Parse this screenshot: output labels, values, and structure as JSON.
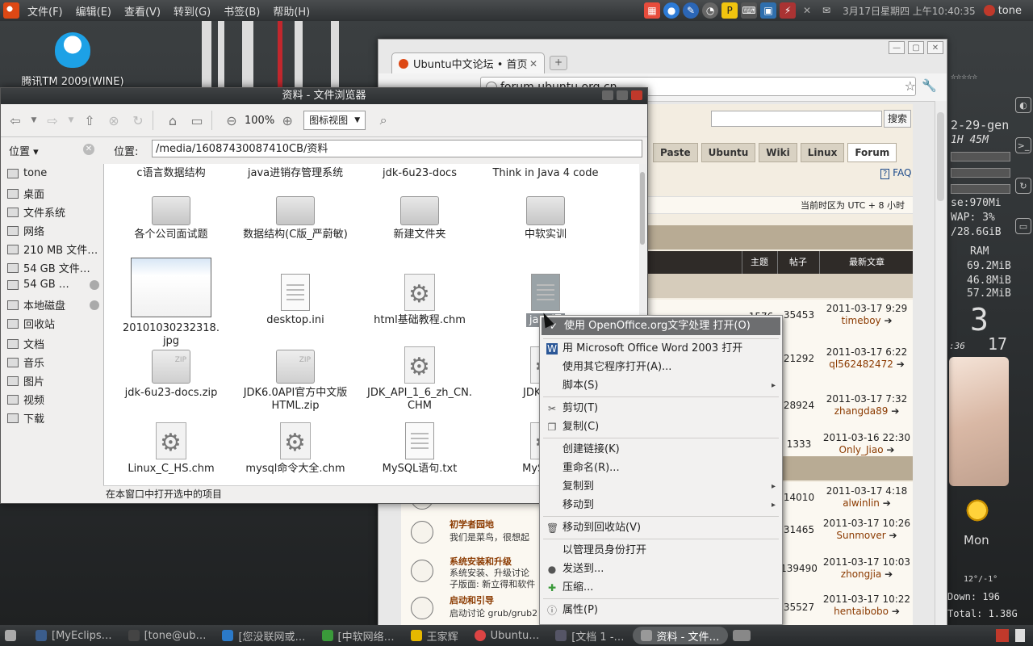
{
  "top_panel": {
    "menus": [
      "文件(F)",
      "编辑(E)",
      "查看(V)",
      "转到(G)",
      "书签(B)",
      "帮助(H)"
    ],
    "clock": "3月17日星期四 上午10:40:35",
    "user": "tone"
  },
  "desktop": {
    "qq_label": "腾讯TM 2009(WINE)"
  },
  "conky": {
    "date": "2-29-gen",
    "uptime": "1H 45M",
    "use": "se:970Mi",
    "swap": "WAP:  3%",
    "disk": "/28.6GiB",
    "ram_title": "RAM",
    "ram1": "69.2MiB",
    "ram2": "46.8MiB",
    "ram3": "57.2MiB",
    "big_digit": "3",
    "small_a": ":36",
    "small_b": "17",
    "day": "Mon",
    "temp": "12°/-1°",
    "down": "Down: 196",
    "total": "Total: 1.38G",
    "stars": "☆☆☆☆☆"
  },
  "browser": {
    "tab_title": "Ubuntu中文论坛 • 首页",
    "url": "forum.ubuntu.org.cn",
    "search_button": "搜索",
    "nav": [
      "Paste",
      "Ubuntu",
      "Wiki",
      "Linux",
      "Forum"
    ],
    "faq": "FAQ",
    "timezone": "当前时区为 UTC + 8 小时",
    "headers": {
      "topics": "主题",
      "posts": "帖子",
      "last": "最新文章"
    },
    "rows": [
      {
        "topics": "1576",
        "posts": "35453",
        "date": "2011-03-17 9:29",
        "who": "timeboy"
      },
      {
        "topics": "",
        "posts": "21292",
        "date": "2011-03-17 6:22",
        "who": "ql562482472"
      },
      {
        "topics": "",
        "posts": "28924",
        "date": "2011-03-17 7:32",
        "who": "zhangda89"
      },
      {
        "topics": "",
        "posts": "1333",
        "date": "2011-03-16 22:30",
        "who": "Only_Jiao"
      },
      {
        "topics": "",
        "posts": "14010",
        "date": "2011-03-17 4:18",
        "who": "alwinlin"
      },
      {
        "title": "初学者园地",
        "desc": "我们是菜鸟，很想起",
        "topics": "",
        "posts": "31465",
        "date": "2011-03-17 10:26",
        "who": "Sunmover"
      },
      {
        "title": "系统安装和升级",
        "desc": "系统安装、升级讨论",
        "desc2": "子版面: 新立得和软件",
        "topics": "",
        "posts": "139490",
        "date": "2011-03-17 10:03",
        "who": "zhongjia"
      },
      {
        "title": "启动和引导",
        "desc": "启动讨论 grub/grub2",
        "topics": "",
        "posts": "35527",
        "date": "2011-03-17 10:22",
        "who": "hentaibobo"
      }
    ]
  },
  "filemanager": {
    "title": "资料 - 文件浏览器",
    "zoom": "100%",
    "view_mode": "图标视图",
    "sidebar_title": "位置",
    "location_label": "位置:",
    "path": "/media/16087430087410CB/资料",
    "places": [
      "tone",
      "桌面",
      "文件系统",
      "网络",
      "210 MB 文件…",
      "54 GB 文件…",
      "54 GB …",
      "本地磁盘",
      "回收站",
      "文档",
      "音乐",
      "图片",
      "视频",
      "下载"
    ],
    "files": [
      {
        "name": "c语言数据结构",
        "kind": "folder"
      },
      {
        "name": "java进销存管理系统",
        "kind": "folder"
      },
      {
        "name": "jdk-6u23-docs",
        "kind": "folder"
      },
      {
        "name": "Think in Java 4 code",
        "kind": "folder"
      },
      {
        "name": "各个公司面试题",
        "kind": "folder"
      },
      {
        "name": "数据结构(C版_严蔚敏)",
        "kind": "folder"
      },
      {
        "name": "新建文件夹",
        "kind": "folder"
      },
      {
        "name": "中软实训",
        "kind": "folder"
      },
      {
        "name": "20101030232318.",
        "name2": "jpg",
        "kind": "image"
      },
      {
        "name": "desktop.ini",
        "kind": "doc"
      },
      {
        "name": "html基础教程.chm",
        "kind": "gear"
      },
      {
        "name": "java语",
        "kind": "odt"
      },
      {
        "name": "jdk-6u23-docs.zip",
        "kind": "zip"
      },
      {
        "name": "JDK6.0API官方中文版",
        "name2": "HTML.zip",
        "kind": "zip"
      },
      {
        "name": "JDK_API_1_6_zh_CN.",
        "name2": "CHM",
        "kind": "gear"
      },
      {
        "name": "JDK_API_",
        "name2": "c",
        "kind": "gear"
      },
      {
        "name": "Linux_C_HS.chm",
        "kind": "gear"
      },
      {
        "name": "mysql命令大全.chm",
        "kind": "gear"
      },
      {
        "name": "MySQL语句.txt",
        "kind": "doc"
      },
      {
        "name": "MySQL中",
        "kind": "gear"
      }
    ],
    "status": "在本窗口中打开选中的项目"
  },
  "context_menu": {
    "items": [
      {
        "label": "使用 OpenOffice.org文字处理 打开(O)",
        "icon": "check-icon"
      },
      {
        "label": "用 Microsoft Office Word 2003 打开",
        "icon": "word-icon"
      },
      {
        "label": "使用其它程序打开(A)..."
      },
      {
        "label": "脚本(S)",
        "submenu": true
      },
      {
        "label": "剪切(T)",
        "icon": "scissors-icon"
      },
      {
        "label": "复制(C)",
        "icon": "copy-icon"
      },
      {
        "label": "创建链接(K)"
      },
      {
        "label": "重命名(R)..."
      },
      {
        "label": "复制到",
        "submenu": true
      },
      {
        "label": "移动到",
        "submenu": true
      },
      {
        "label": "移动到回收站(V)",
        "icon": "trash-icon"
      },
      {
        "label": "以管理员身份打开"
      },
      {
        "label": "发送到...",
        "icon": "send-icon"
      },
      {
        "label": "压缩...",
        "icon": "compress-icon"
      },
      {
        "label": "属性(P)",
        "icon": "properties-icon"
      }
    ]
  },
  "taskbar": {
    "tasks": [
      "[MyEclips…",
      "[tone@ub…",
      "[您没联网或…",
      "[中软网络…",
      "王家辉",
      "Ubuntu…",
      "[文档 1 -…",
      "资料 - 文件…"
    ]
  }
}
